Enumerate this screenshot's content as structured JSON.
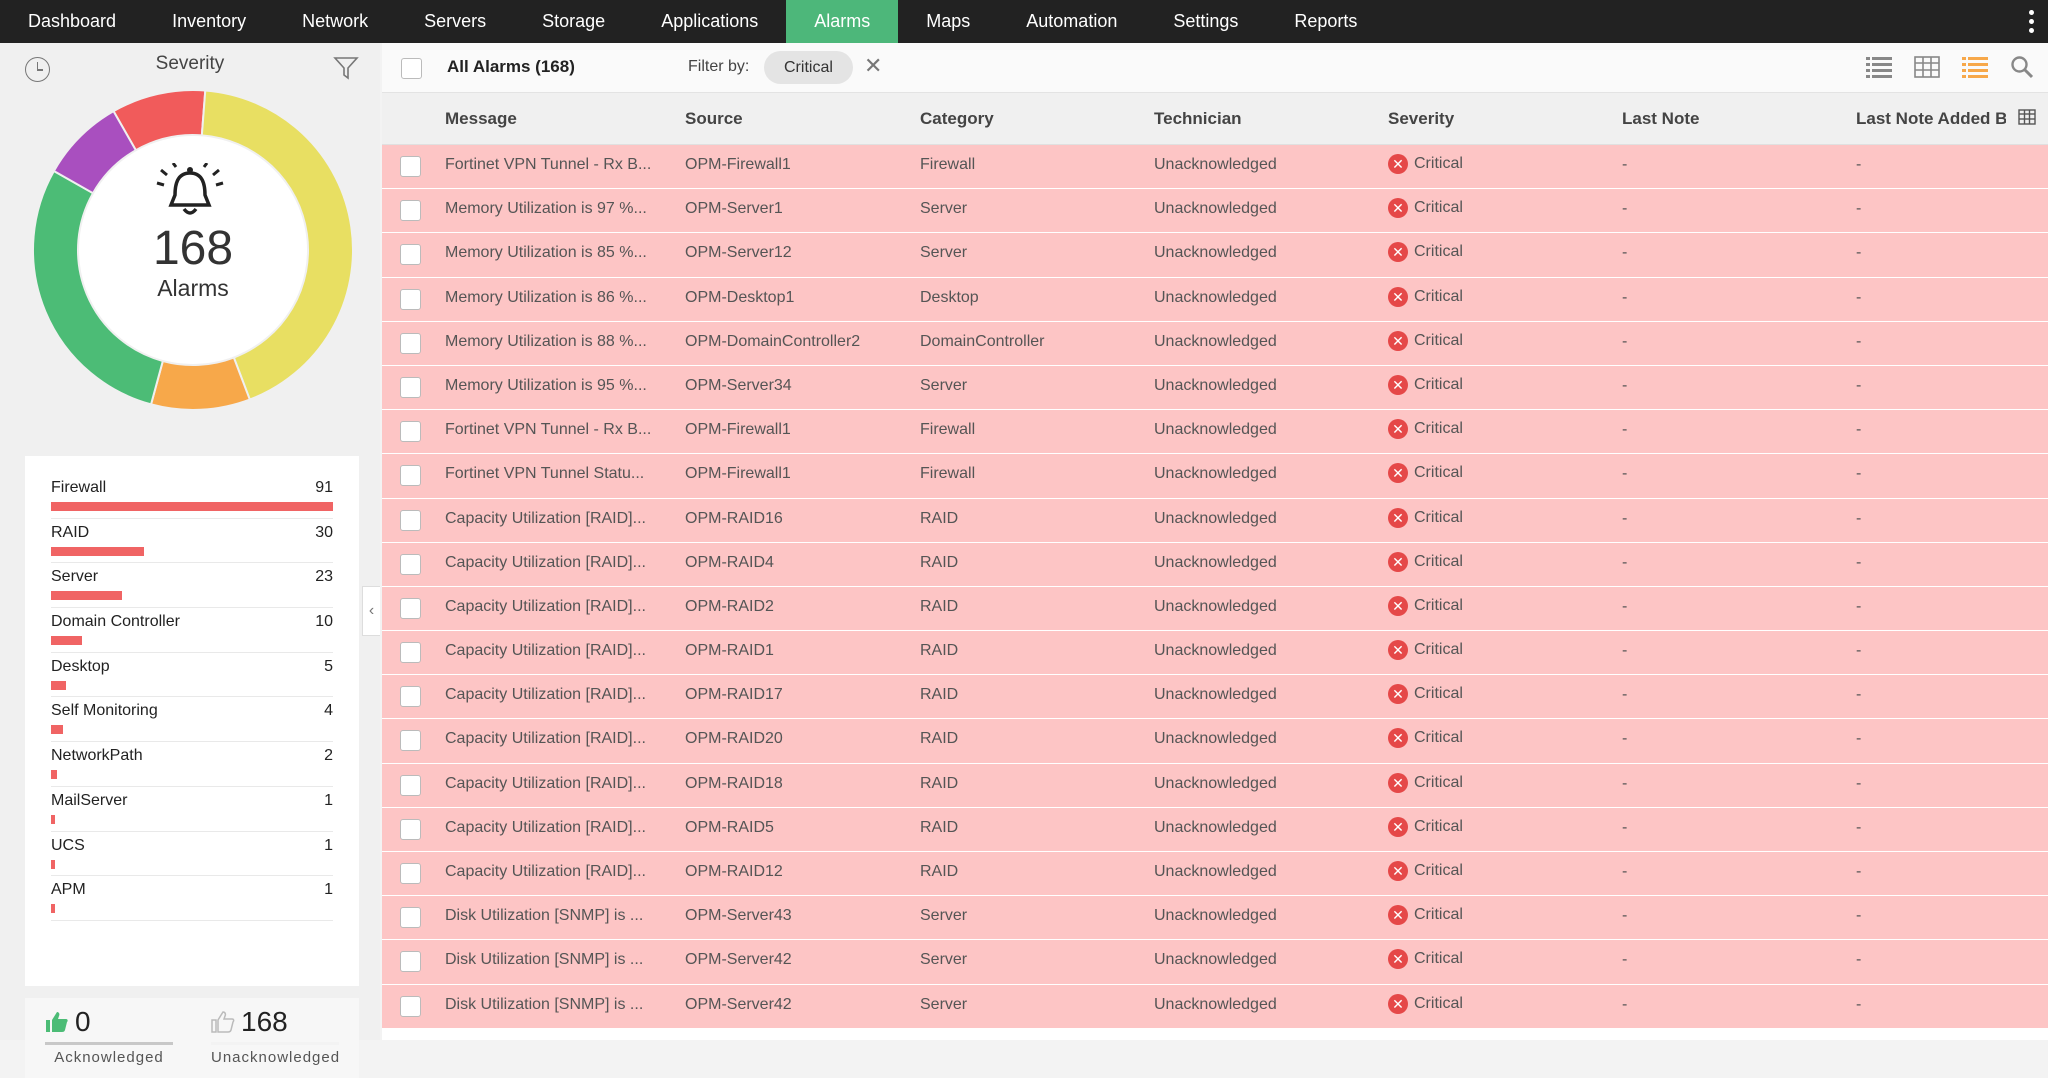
{
  "nav": {
    "items": [
      "Dashboard",
      "Inventory",
      "Network",
      "Servers",
      "Storage",
      "Applications",
      "Alarms",
      "Maps",
      "Automation",
      "Settings",
      "Reports"
    ],
    "active": "Alarms"
  },
  "left_panel": {
    "title": "Severity",
    "total": "168",
    "total_label": "Alarms",
    "donut_segments": [
      {
        "name": "critical",
        "color": "#f15b5b",
        "value": 0.095
      },
      {
        "name": "trouble",
        "color": "#e8df62",
        "value": 0.43
      },
      {
        "name": "attention",
        "color": "#f7a84a",
        "value": 0.1
      },
      {
        "name": "clear",
        "color": "#4cbc76",
        "value": 0.29
      },
      {
        "name": "service-down",
        "color": "#a94fbf",
        "value": 0.085
      }
    ],
    "categories": [
      {
        "name": "Firewall",
        "count": "91",
        "value": 91
      },
      {
        "name": "RAID",
        "count": "30",
        "value": 30
      },
      {
        "name": "Server",
        "count": "23",
        "value": 23
      },
      {
        "name": "Domain Controller",
        "count": "10",
        "value": 10
      },
      {
        "name": "Desktop",
        "count": "5",
        "value": 5
      },
      {
        "name": "Self Monitoring",
        "count": "4",
        "value": 4
      },
      {
        "name": "NetworkPath",
        "count": "2",
        "value": 2
      },
      {
        "name": "MailServer",
        "count": "1",
        "value": 1
      },
      {
        "name": "UCS",
        "count": "1",
        "value": 1
      },
      {
        "name": "APM",
        "count": "1",
        "value": 1
      }
    ],
    "acknowledged": {
      "count": "0",
      "label": "Acknowledged"
    },
    "unacknowledged": {
      "count": "168",
      "label": "Unacknowledged"
    }
  },
  "toolbar": {
    "title": "All Alarms (168)",
    "filter_label": "Filter by:",
    "filter_value": "Critical"
  },
  "table": {
    "columns": [
      "Message",
      "Source",
      "Category",
      "Technician",
      "Severity",
      "Last Note",
      "Last Note Added B"
    ],
    "rows": [
      [
        "Fortinet VPN Tunnel - Rx B...",
        "OPM-Firewall1",
        "Firewall",
        "Unacknowledged",
        "Critical",
        "-",
        "-"
      ],
      [
        "Memory Utilization is 97 %...",
        "OPM-Server1",
        "Server",
        "Unacknowledged",
        "Critical",
        "-",
        "-"
      ],
      [
        "Memory Utilization is 85 %...",
        "OPM-Server12",
        "Server",
        "Unacknowledged",
        "Critical",
        "-",
        "-"
      ],
      [
        "Memory Utilization is 86 %...",
        "OPM-Desktop1",
        "Desktop",
        "Unacknowledged",
        "Critical",
        "-",
        "-"
      ],
      [
        "Memory Utilization is 88 %...",
        "OPM-DomainController2",
        "DomainController",
        "Unacknowledged",
        "Critical",
        "-",
        "-"
      ],
      [
        "Memory Utilization is 95 %...",
        "OPM-Server34",
        "Server",
        "Unacknowledged",
        "Critical",
        "-",
        "-"
      ],
      [
        "Fortinet VPN Tunnel - Rx B...",
        "OPM-Firewall1",
        "Firewall",
        "Unacknowledged",
        "Critical",
        "-",
        "-"
      ],
      [
        "Fortinet VPN Tunnel Statu...",
        "OPM-Firewall1",
        "Firewall",
        "Unacknowledged",
        "Critical",
        "-",
        "-"
      ],
      [
        "Capacity Utilization [RAID]...",
        "OPM-RAID16",
        "RAID",
        "Unacknowledged",
        "Critical",
        "-",
        "-"
      ],
      [
        "Capacity Utilization [RAID]...",
        "OPM-RAID4",
        "RAID",
        "Unacknowledged",
        "Critical",
        "-",
        "-"
      ],
      [
        "Capacity Utilization [RAID]...",
        "OPM-RAID2",
        "RAID",
        "Unacknowledged",
        "Critical",
        "-",
        "-"
      ],
      [
        "Capacity Utilization [RAID]...",
        "OPM-RAID1",
        "RAID",
        "Unacknowledged",
        "Critical",
        "-",
        "-"
      ],
      [
        "Capacity Utilization [RAID]...",
        "OPM-RAID17",
        "RAID",
        "Unacknowledged",
        "Critical",
        "-",
        "-"
      ],
      [
        "Capacity Utilization [RAID]...",
        "OPM-RAID20",
        "RAID",
        "Unacknowledged",
        "Critical",
        "-",
        "-"
      ],
      [
        "Capacity Utilization [RAID]...",
        "OPM-RAID18",
        "RAID",
        "Unacknowledged",
        "Critical",
        "-",
        "-"
      ],
      [
        "Capacity Utilization [RAID]...",
        "OPM-RAID5",
        "RAID",
        "Unacknowledged",
        "Critical",
        "-",
        "-"
      ],
      [
        "Capacity Utilization [RAID]...",
        "OPM-RAID12",
        "RAID",
        "Unacknowledged",
        "Critical",
        "-",
        "-"
      ],
      [
        "Disk Utilization [SNMP] is ...",
        "OPM-Server43",
        "Server",
        "Unacknowledged",
        "Critical",
        "-",
        "-"
      ],
      [
        "Disk Utilization [SNMP] is ...",
        "OPM-Server42",
        "Server",
        "Unacknowledged",
        "Critical",
        "-",
        "-"
      ],
      [
        "Disk Utilization [SNMP] is ...",
        "OPM-Server42",
        "Server",
        "Unacknowledged",
        "Critical",
        "-",
        "-"
      ]
    ]
  }
}
